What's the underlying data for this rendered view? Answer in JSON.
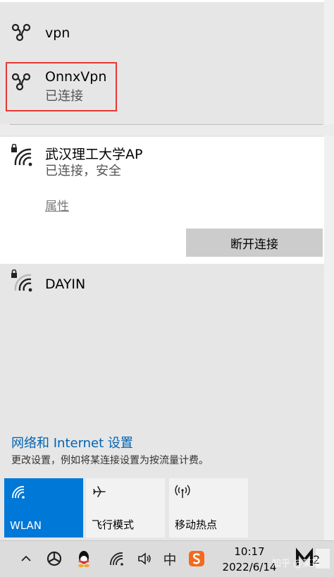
{
  "networks": {
    "vpn1": {
      "name": "vpn"
    },
    "vpn2": {
      "name": "OnnxVpn",
      "status": "已连接"
    },
    "wifi_connected": {
      "name": "武汉理工大学AP",
      "status": "已连接，安全",
      "properties_link": "属性",
      "disconnect_button": "断开连接"
    },
    "wifi_other": {
      "name": "DAYIN"
    }
  },
  "settings": {
    "title": "网络和 Internet 设置",
    "description": "更改设置，例如将某连接设置为按流量计费。"
  },
  "quick_actions": [
    {
      "label": "WLAN",
      "icon": "wifi-icon",
      "active": true
    },
    {
      "label": "飞行模式",
      "icon": "airplane-icon",
      "active": false
    },
    {
      "label": "移动热点",
      "icon": "hotspot-icon",
      "active": false
    }
  ],
  "taskbar": {
    "time": "10:17",
    "date": "2022/6/14",
    "ime_label": "中",
    "notification_count": "2",
    "watermark": "知乎 @某某"
  },
  "colors": {
    "accent": "#0078d7",
    "link": "#0063b1",
    "highlight_box": "#e53935"
  }
}
